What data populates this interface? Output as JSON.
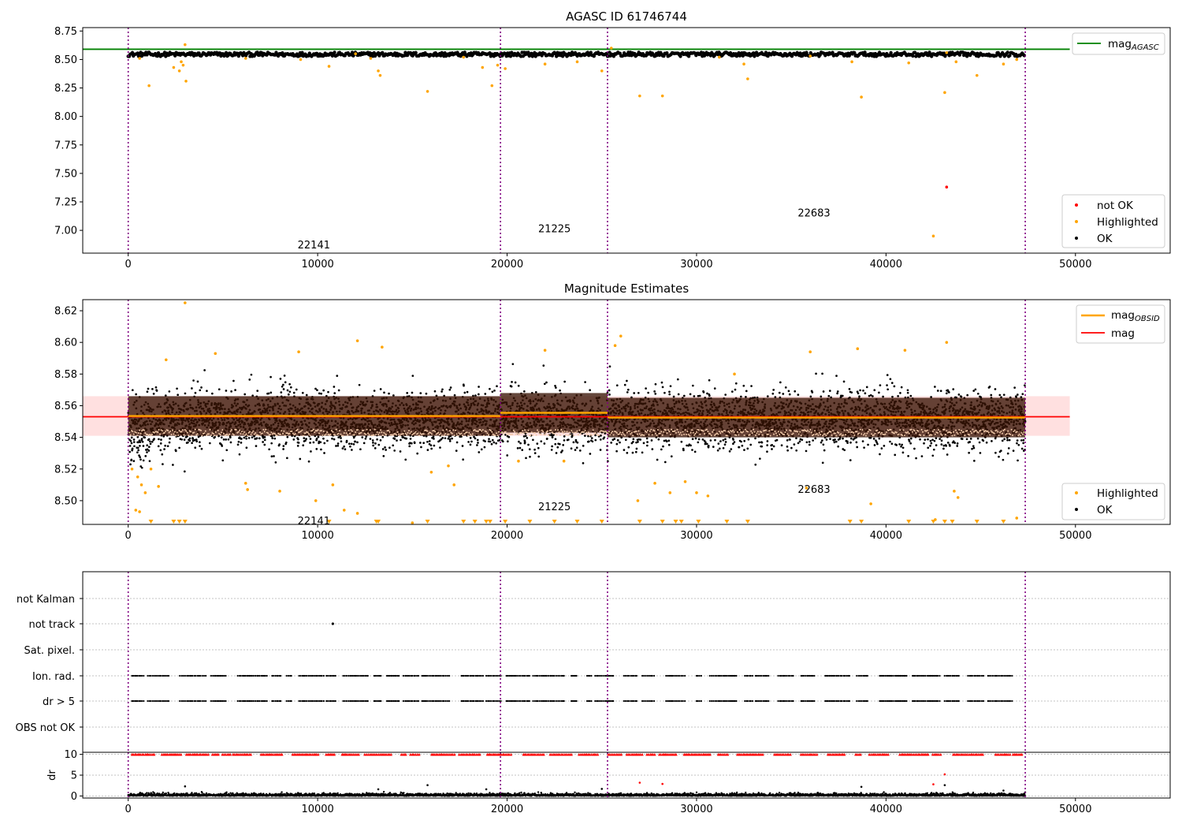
{
  "figure": {
    "panel1_title": "AGASC ID 61746744",
    "panel2_title": "Magnitude Estimates"
  },
  "chart_data": [
    {
      "type": "scatter",
      "title": "AGASC ID 61746744",
      "xlim": [
        -2400,
        55000
      ],
      "ylim": [
        6.8,
        8.78
      ],
      "x_ticks": [
        0,
        10000,
        20000,
        30000,
        40000,
        50000
      ],
      "y_ticks": [
        7.0,
        7.25,
        7.5,
        7.75,
        8.0,
        8.25,
        8.5,
        8.75
      ],
      "obsid_boundaries": [
        0,
        19650,
        25300,
        47350
      ],
      "obsid_labels": [
        {
          "text": "22141",
          "x": 9800,
          "y": 6.87
        },
        {
          "text": "21225",
          "x": 22500,
          "y": 7.01
        },
        {
          "text": "22683",
          "x": 36200,
          "y": 7.15
        }
      ],
      "reference_lines": [
        {
          "name": "mag",
          "sub": "AGASC",
          "value": 8.59,
          "x_range": [
            -2400,
            49700
          ],
          "color": "#008000"
        }
      ],
      "series": [
        {
          "name": "not OK",
          "color": "#ff0000",
          "points": [
            [
              43200,
              7.38
            ]
          ]
        },
        {
          "name": "Highlighted",
          "color": "#ffa500",
          "points": [
            [
              600,
              8.51
            ],
            [
              1100,
              8.27
            ],
            [
              2400,
              8.43
            ],
            [
              2700,
              8.4
            ],
            [
              2900,
              8.45
            ],
            [
              3000,
              8.63
            ],
            [
              3050,
              8.31
            ],
            [
              2800,
              8.48
            ],
            [
              6200,
              8.51
            ],
            [
              9100,
              8.5
            ],
            [
              10600,
              8.44
            ],
            [
              12000,
              8.55
            ],
            [
              12800,
              8.51
            ],
            [
              13200,
              8.4
            ],
            [
              13300,
              8.36
            ],
            [
              15800,
              8.22
            ],
            [
              17700,
              8.52
            ],
            [
              18700,
              8.43
            ],
            [
              19200,
              8.27
            ],
            [
              19500,
              8.45
            ],
            [
              19900,
              8.42
            ],
            [
              22000,
              8.46
            ],
            [
              23700,
              8.48
            ],
            [
              25000,
              8.4
            ],
            [
              25500,
              8.6
            ],
            [
              27000,
              8.18
            ],
            [
              28200,
              8.18
            ],
            [
              31200,
              8.52
            ],
            [
              32500,
              8.46
            ],
            [
              32700,
              8.33
            ],
            [
              36000,
              8.53
            ],
            [
              38200,
              8.48
            ],
            [
              38700,
              8.17
            ],
            [
              41200,
              8.47
            ],
            [
              42500,
              6.95
            ],
            [
              43100,
              8.21
            ],
            [
              43200,
              8.56
            ],
            [
              43700,
              8.48
            ],
            [
              44800,
              8.36
            ],
            [
              46200,
              8.46
            ],
            [
              46900,
              8.5
            ]
          ]
        }
      ],
      "ok_band": {
        "center": 8.545,
        "spread": 0.022
      },
      "legend": [
        {
          "label": "mag",
          "sub": "AGASC",
          "color": "#008000",
          "kind": "line"
        },
        {
          "label": "not OK",
          "color": "#ff0000",
          "kind": "dot"
        },
        {
          "label": "Highlighted",
          "color": "#ffa500",
          "kind": "dot"
        },
        {
          "label": "OK",
          "color": "#000000",
          "kind": "dot"
        }
      ]
    },
    {
      "type": "scatter",
      "title": "Magnitude Estimates",
      "xlim": [
        -2400,
        55000
      ],
      "ylim": [
        8.485,
        8.627
      ],
      "x_ticks": [
        0,
        10000,
        20000,
        30000,
        40000,
        50000
      ],
      "y_ticks": [
        8.5,
        8.52,
        8.54,
        8.56,
        8.58,
        8.6,
        8.62
      ],
      "obsid_boundaries": [
        0,
        19650,
        25300,
        47350
      ],
      "obsid_labels": [
        {
          "text": "22141",
          "x": 9800,
          "y": 8.487
        },
        {
          "text": "21225",
          "x": 22500,
          "y": 8.496
        },
        {
          "text": "22683",
          "x": 36200,
          "y": 8.507
        }
      ],
      "mag": {
        "name": "mag",
        "value": 8.553,
        "band": [
          8.541,
          8.566
        ],
        "x_range": [
          -2400,
          49700
        ],
        "color": "#ff0000"
      },
      "mag_obsid": [
        {
          "x": [
            0,
            19650
          ],
          "value": 8.5535,
          "band": [
            8.541,
            8.566
          ]
        },
        {
          "x": [
            19650,
            25300
          ],
          "value": 8.5555,
          "band": [
            8.543,
            8.568
          ]
        },
        {
          "x": [
            25300,
            47350
          ],
          "value": 8.5525,
          "band": [
            8.54,
            8.565
          ]
        }
      ],
      "highlighted_bottom_x": [
        1200,
        2400,
        2700,
        3000,
        10600,
        13100,
        13200,
        15800,
        17700,
        18300,
        18900,
        19100,
        19900,
        21200,
        22500,
        23700,
        25000,
        27000,
        28200,
        28900,
        29200,
        30100,
        31600,
        32700,
        38100,
        38700,
        41200,
        42500,
        43100,
        43500,
        44800,
        46200
      ],
      "highlighted_points": [
        [
          3000,
          8.625
        ],
        [
          200,
          8.52
        ],
        [
          500,
          8.515
        ],
        [
          700,
          8.51
        ],
        [
          900,
          8.505
        ],
        [
          1200,
          8.52
        ],
        [
          1600,
          8.509
        ],
        [
          400,
          8.494
        ],
        [
          600,
          8.493
        ],
        [
          6300,
          8.507
        ],
        [
          6200,
          8.511
        ],
        [
          8000,
          8.506
        ],
        [
          9900,
          8.5
        ],
        [
          10800,
          8.51
        ],
        [
          11400,
          8.494
        ],
        [
          12100,
          8.492
        ],
        [
          12100,
          8.601
        ],
        [
          13400,
          8.597
        ],
        [
          15000,
          8.486
        ],
        [
          16000,
          8.518
        ],
        [
          16900,
          8.522
        ],
        [
          17200,
          8.51
        ],
        [
          20600,
          8.525
        ],
        [
          22000,
          8.595
        ],
        [
          23000,
          8.525
        ],
        [
          26000,
          8.604
        ],
        [
          25700,
          8.598
        ],
        [
          26900,
          8.5
        ],
        [
          27800,
          8.511
        ],
        [
          28600,
          8.505
        ],
        [
          29400,
          8.512
        ],
        [
          30000,
          8.505
        ],
        [
          30600,
          8.503
        ],
        [
          32000,
          8.58
        ],
        [
          35800,
          8.508
        ],
        [
          36000,
          8.594
        ],
        [
          38500,
          8.596
        ],
        [
          39200,
          8.498
        ],
        [
          41000,
          8.595
        ],
        [
          42600,
          8.488
        ],
        [
          43200,
          8.6
        ],
        [
          43600,
          8.506
        ],
        [
          43800,
          8.502
        ],
        [
          46900,
          8.489
        ],
        [
          9000,
          8.594
        ],
        [
          4600,
          8.593
        ],
        [
          2000,
          8.589
        ]
      ],
      "ok_band": {
        "center": 8.551,
        "spread": 0.012
      },
      "legend": [
        {
          "label": "mag",
          "sub": "OBSID",
          "color": "#ffa500",
          "kind": "line"
        },
        {
          "label": "mag",
          "color": "#ff0000",
          "kind": "line"
        },
        {
          "label": "Highlighted",
          "color": "#ffa500",
          "kind": "dot"
        },
        {
          "label": "OK",
          "color": "#000000",
          "kind": "dot"
        }
      ]
    },
    {
      "type": "scatter",
      "xlim": [
        -2400,
        55000
      ],
      "y_categories": [
        "not Kalman",
        "not track",
        "Sat. pixel.",
        "Ion. rad.",
        "dr > 5",
        "OBS not OK"
      ],
      "obsid_boundaries": [
        0,
        19650,
        25300,
        47350
      ],
      "flag_points": {
        "not track": [
          10800
        ]
      },
      "flag_rows_with_sampling": [
        "Ion. rad.",
        "dr > 5"
      ],
      "flag_x_range": [
        200,
        47200
      ]
    },
    {
      "type": "scatter",
      "xlim": [
        -2400,
        55000
      ],
      "ylim": [
        -0.5,
        10.5
      ],
      "ylabel": "dr",
      "y_ticks": [
        0,
        5,
        10
      ],
      "x_ticks": [
        0,
        10000,
        20000,
        30000,
        40000,
        50000
      ],
      "obsid_boundaries": [
        0,
        19650,
        25300,
        47350
      ],
      "clipped_value": 10,
      "red_points": [
        [
          27000,
          3.2
        ],
        [
          28200,
          2.9
        ],
        [
          42500,
          2.8
        ],
        [
          43100,
          5.2
        ]
      ],
      "outlier_points": [
        [
          3000,
          2.3
        ],
        [
          13200,
          1.6
        ],
        [
          15800,
          2.6
        ],
        [
          18900,
          1.6
        ],
        [
          25000,
          1.7
        ],
        [
          38700,
          2.2
        ],
        [
          46200,
          1.3
        ],
        [
          43100,
          2.6
        ]
      ]
    }
  ]
}
